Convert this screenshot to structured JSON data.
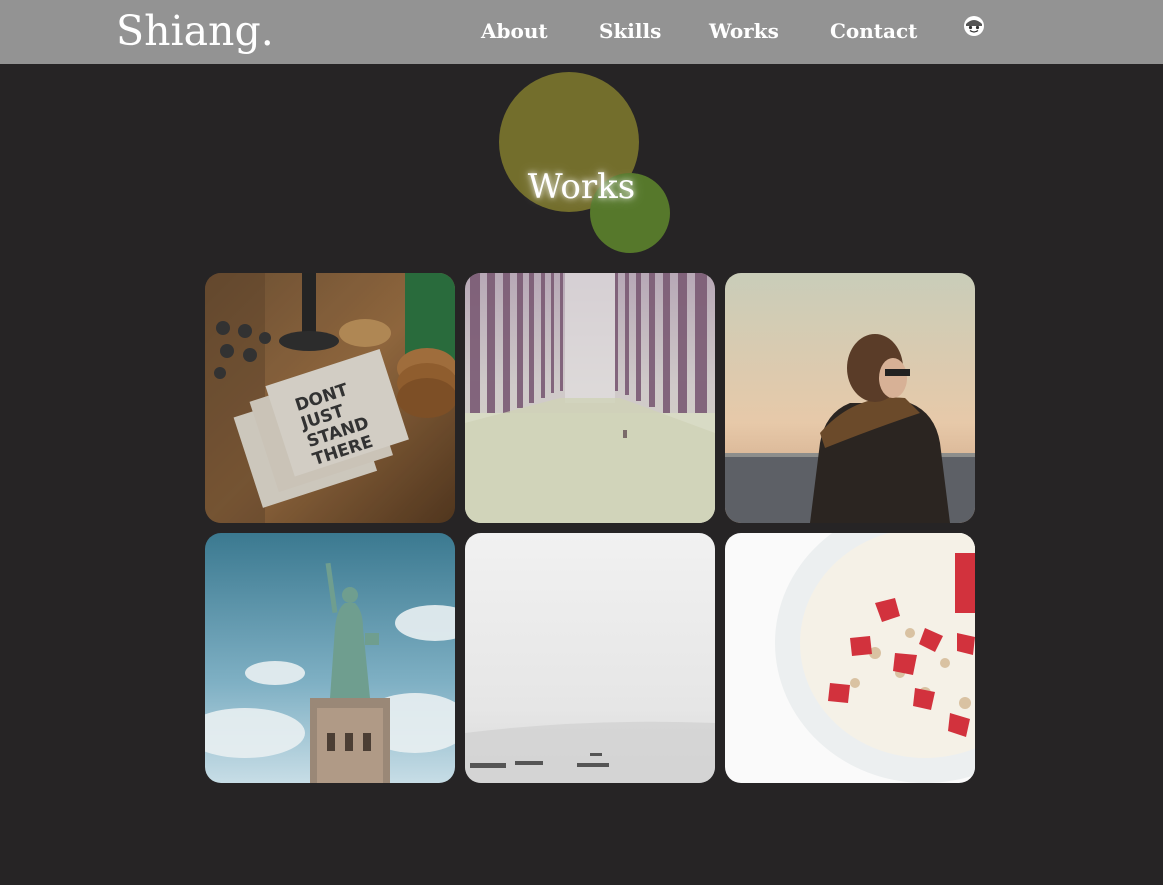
{
  "header": {
    "logo": "Shiang.",
    "nav": [
      {
        "label": "About"
      },
      {
        "label": "Skills"
      },
      {
        "label": "Works"
      },
      {
        "label": "Contact"
      }
    ],
    "avatar_icon": "smiley-face-icon"
  },
  "works": {
    "title": "Works",
    "circle_colors": [
      "#736e2c",
      "#56782b"
    ],
    "items": [
      {
        "subject": "notebook-on-wooden-desk",
        "caption": "DONT JUST STAND THERE"
      },
      {
        "subject": "misty-forest-road"
      },
      {
        "subject": "person-at-seaside-sunset"
      },
      {
        "subject": "statue-of-liberty"
      },
      {
        "subject": "foggy-sea-with-boats"
      },
      {
        "subject": "strawberry-yogurt-bowl"
      }
    ]
  },
  "colors": {
    "background": "#262425",
    "navbar": "#939393",
    "text": "#ffffff"
  }
}
